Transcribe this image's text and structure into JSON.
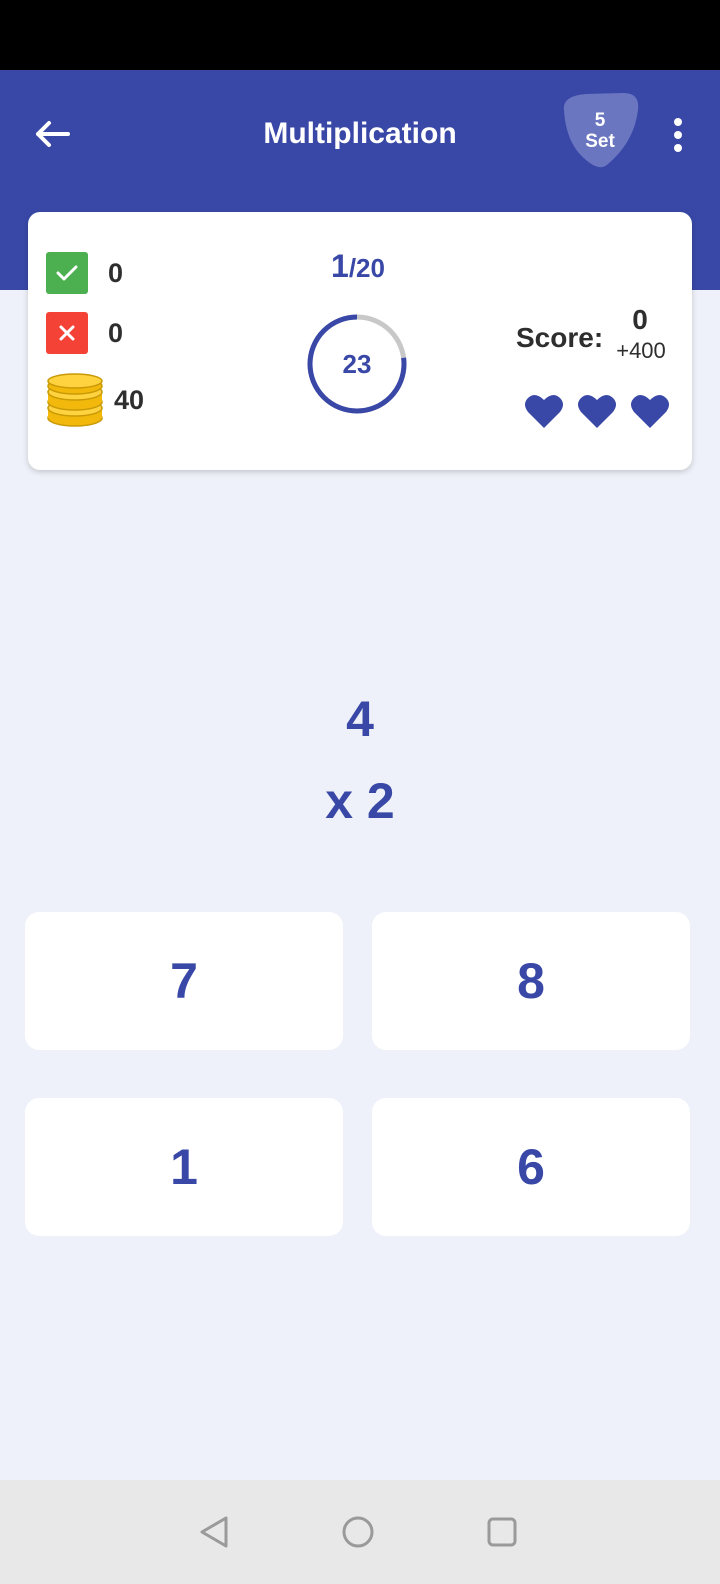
{
  "header": {
    "title": "Multiplication",
    "set_number": "5",
    "set_label": "Set",
    "background_color": "#3948a7"
  },
  "stats": {
    "correct_count": "0",
    "wrong_count": "0",
    "coins": "40",
    "correct_color": "#4caf50",
    "wrong_color": "#f44336"
  },
  "progress": {
    "current": "1",
    "total": "/20",
    "timer": "23",
    "timer_fraction": 0.77
  },
  "score": {
    "label": "Score:",
    "value": "0",
    "bonus": "+400",
    "lives": 3
  },
  "question": {
    "operand_top": "4",
    "operand_bottom": "x 2"
  },
  "answers": [
    "7",
    "8",
    "1",
    "6"
  ],
  "icons": {
    "back": "arrow-left-icon",
    "menu": "more-vert-icon",
    "correct": "check-icon",
    "wrong": "close-icon",
    "coins": "coin-stack-icon",
    "life": "heart-icon"
  }
}
